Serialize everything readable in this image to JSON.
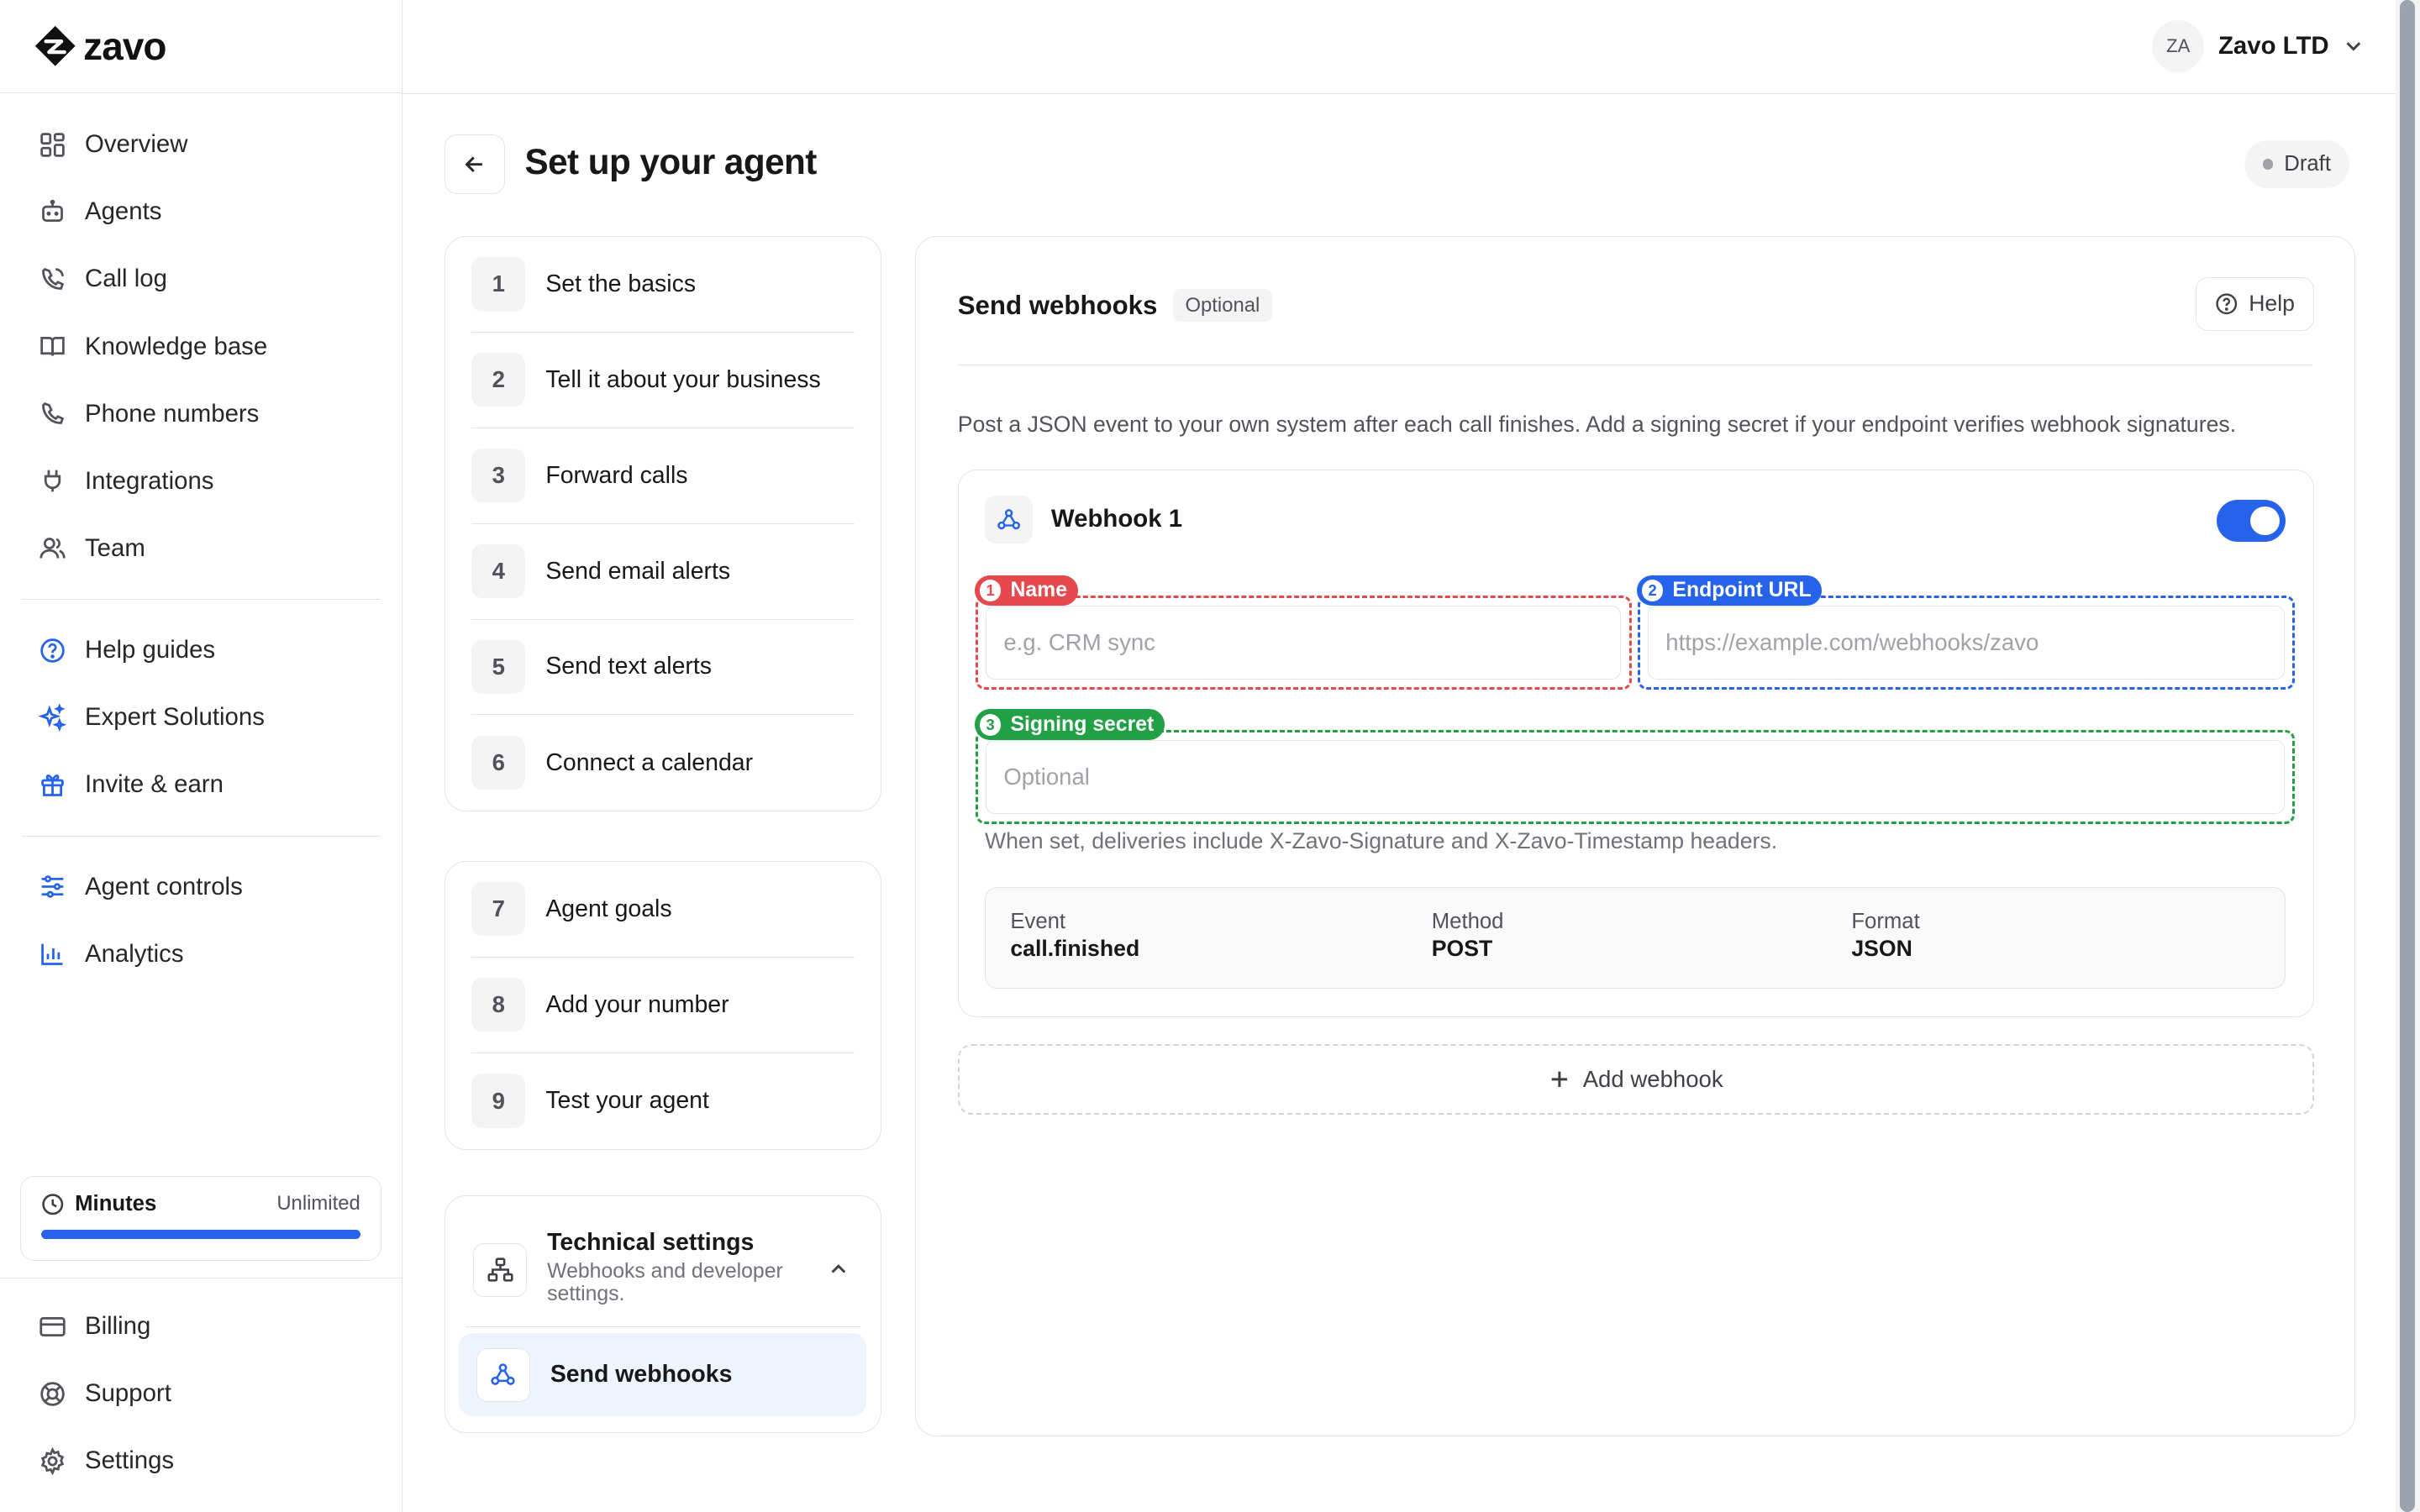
{
  "brand": {
    "name": "zavo"
  },
  "sidebar": {
    "primary": [
      {
        "label": "Overview",
        "icon": "grid-icon"
      },
      {
        "label": "Agents",
        "icon": "robot-icon"
      },
      {
        "label": "Call log",
        "icon": "phone-call-icon"
      },
      {
        "label": "Knowledge base",
        "icon": "book-icon"
      },
      {
        "label": "Phone numbers",
        "icon": "phone-icon"
      },
      {
        "label": "Integrations",
        "icon": "plug-icon"
      },
      {
        "label": "Team",
        "icon": "users-icon"
      }
    ],
    "secondary": [
      {
        "label": "Help guides",
        "icon": "help-circle-icon"
      },
      {
        "label": "Expert Solutions",
        "icon": "sparkles-icon"
      },
      {
        "label": "Invite & earn",
        "icon": "gift-icon"
      }
    ],
    "tertiary": [
      {
        "label": "Agent controls",
        "icon": "sliders-icon"
      },
      {
        "label": "Analytics",
        "icon": "bar-chart-icon"
      }
    ],
    "minutes": {
      "label": "Minutes",
      "value": "Unlimited",
      "fill": 1.0
    },
    "bottom": [
      {
        "label": "Billing",
        "icon": "credit-card-icon"
      },
      {
        "label": "Support",
        "icon": "lifebuoy-icon"
      },
      {
        "label": "Settings",
        "icon": "gear-icon"
      }
    ]
  },
  "header": {
    "account": {
      "initials": "ZA",
      "name": "Zavo LTD"
    }
  },
  "page": {
    "title": "Set up your agent",
    "status": "Draft"
  },
  "steps": {
    "group1": [
      {
        "num": "1",
        "label": "Set the basics"
      },
      {
        "num": "2",
        "label": "Tell it about your business"
      },
      {
        "num": "3",
        "label": "Forward calls"
      },
      {
        "num": "4",
        "label": "Send email alerts"
      },
      {
        "num": "5",
        "label": "Send text alerts"
      },
      {
        "num": "6",
        "label": "Connect a calendar"
      }
    ],
    "group2": [
      {
        "num": "7",
        "label": "Agent goals"
      },
      {
        "num": "8",
        "label": "Add your number"
      },
      {
        "num": "9",
        "label": "Test your agent"
      }
    ],
    "technical": {
      "title": "Technical settings",
      "subtitle": "Webhooks and developer settings.",
      "active_item": "Send webhooks"
    }
  },
  "content": {
    "title": "Send webhooks",
    "badge": "Optional",
    "help_label": "Help",
    "description": "Post a JSON event to your own system after each call finishes. Add a signing secret if your endpoint verifies webhook signatures.",
    "webhook": {
      "title": "Webhook 1",
      "enabled": true,
      "fields": {
        "name": {
          "tag_num": "1",
          "tag": "Name",
          "placeholder": "e.g. CRM sync",
          "color": "#e5484d"
        },
        "endpoint": {
          "tag_num": "2",
          "tag": "Endpoint URL",
          "placeholder": "https://example.com/webhooks/zavo",
          "color": "#2563eb"
        },
        "secret": {
          "tag_num": "3",
          "tag": "Signing secret",
          "placeholder": "Optional",
          "color": "#22a046"
        }
      },
      "hint": "When set, deliveries include X-Zavo-Signature and X-Zavo-Timestamp headers.",
      "meta": [
        {
          "label": "Event",
          "value": "call.finished"
        },
        {
          "label": "Method",
          "value": "POST"
        },
        {
          "label": "Format",
          "value": "JSON"
        }
      ]
    },
    "add_label": "Add webhook"
  }
}
